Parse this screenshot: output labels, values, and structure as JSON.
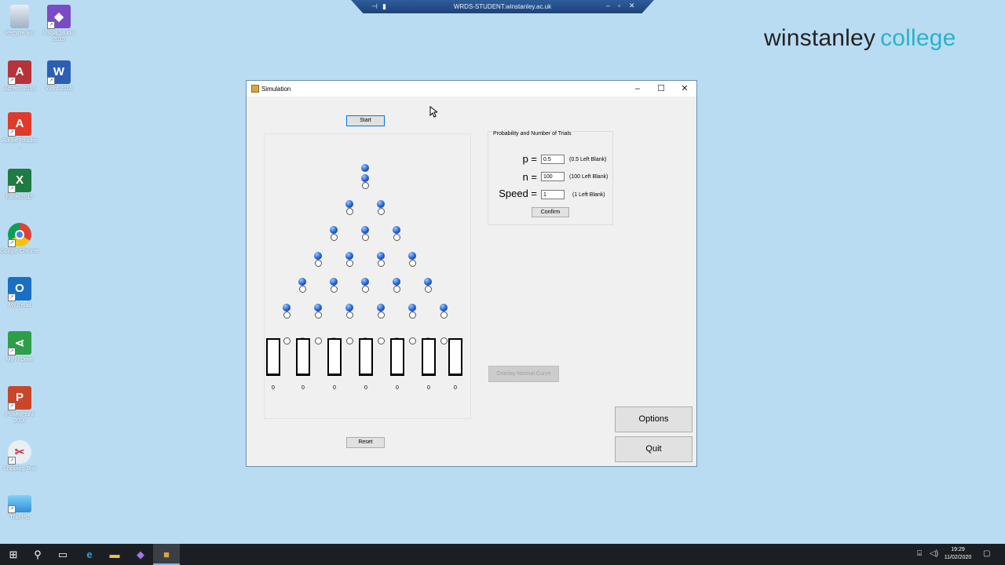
{
  "remote_bar": {
    "title": "WRDS-STUDENT.winstanley.ac.uk"
  },
  "brand": {
    "word1": "winstanley",
    "word2": "college"
  },
  "desktop_icons": [
    {
      "label": "Recycle Bin"
    },
    {
      "label": "Visual Studio 2019"
    },
    {
      "label": "Access 2016"
    },
    {
      "label": "Word 2016"
    },
    {
      "label": "Adobe Reader ..."
    },
    {
      "label": "Excel 2016"
    },
    {
      "label": "Google Chrome"
    },
    {
      "label": "My Email"
    },
    {
      "label": "My N Drive"
    },
    {
      "label": "PowerPoint 2016"
    },
    {
      "label": "Snipping Tool"
    },
    {
      "label": "This PC"
    }
  ],
  "window": {
    "title": "Simulation",
    "start_label": "Start",
    "reset_label": "Reset",
    "options_label": "Options",
    "quit_label": "Quit",
    "overlay_label": "Overlay Normal Curve",
    "bin_counts": [
      "0",
      "0",
      "0",
      "0",
      "0",
      "0",
      "0"
    ],
    "params": {
      "group_title": "Probability and Number of Trials",
      "p_label": "p =",
      "p_value": "0.5",
      "p_hint": "(0.5 Left Blank)",
      "n_label": "n =",
      "n_value": "100",
      "n_hint": "(100 Left Blank)",
      "speed_label": "Speed =",
      "speed_value": "1",
      "speed_hint": "(1 Left Blank)",
      "confirm_label": "Confirm"
    }
  },
  "taskbar": {
    "time": "19:29",
    "date": "11/02/2020"
  }
}
